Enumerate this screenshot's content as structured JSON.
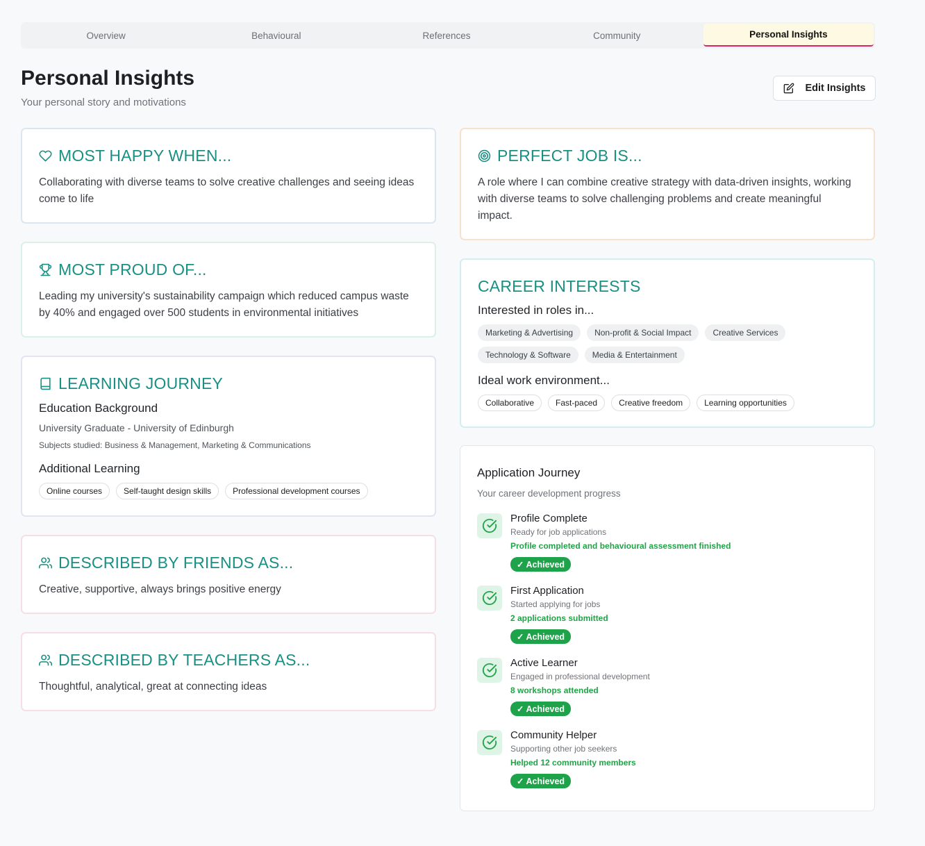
{
  "tabs": [
    "Overview",
    "Behavioural",
    "References",
    "Community",
    "Personal Insights"
  ],
  "header": {
    "title": "Personal Insights",
    "subtitle": "Your personal story and motivations",
    "edit_label": "Edit Insights"
  },
  "happy": {
    "title": "MOST HAPPY WHEN...",
    "body": "Collaborating with diverse teams to solve creative challenges and seeing ideas come to life"
  },
  "proud": {
    "title": "MOST PROUD OF...",
    "body": "Leading my university's sustainability campaign which reduced campus waste by 40% and engaged over 500 students in environmental initiatives"
  },
  "learning": {
    "title": "LEARNING JOURNEY",
    "edu_heading": "Education Background",
    "edu_line": "University Graduate - University of Edinburgh",
    "edu_subjects": "Subjects studied: Business & Management, Marketing & Communications",
    "additional_heading": "Additional Learning",
    "chips": [
      "Online courses",
      "Self-taught design skills",
      "Professional development courses"
    ]
  },
  "friends": {
    "title": "DESCRIBED BY FRIENDS AS...",
    "body": "Creative, supportive, always brings positive energy"
  },
  "teachers": {
    "title": "DESCRIBED BY TEACHERS AS...",
    "body": "Thoughtful, analytical, great at connecting ideas"
  },
  "perfect": {
    "title": "PERFECT JOB IS...",
    "body": "A role where I can combine creative strategy with data-driven insights, working with diverse teams to solve challenging problems and create meaningful impact."
  },
  "career": {
    "title": "CAREER INTERESTS",
    "roles_heading": "Interested in roles in...",
    "roles": [
      "Marketing & Advertising",
      "Non-profit & Social Impact",
      "Creative Services",
      "Technology & Software",
      "Media & Entertainment"
    ],
    "env_heading": "Ideal work environment...",
    "environments": [
      "Collaborative",
      "Fast-paced",
      "Creative freedom",
      "Learning opportunities"
    ]
  },
  "journey": {
    "title": "Application Journey",
    "subtitle": "Your career development progress",
    "milestones": [
      {
        "title": "Profile Complete",
        "desc": "Ready for job applications",
        "detail": "Profile completed and behavioural assessment finished",
        "badge": "✓ Achieved"
      },
      {
        "title": "First Application",
        "desc": "Started applying for jobs",
        "detail": "2 applications submitted",
        "badge": "✓ Achieved"
      },
      {
        "title": "Active Learner",
        "desc": "Engaged in professional development",
        "detail": "8 workshops attended",
        "badge": "✓ Achieved"
      },
      {
        "title": "Community Helper",
        "desc": "Supporting other job seekers",
        "detail": "Helped 12 community members",
        "badge": "✓ Achieved"
      }
    ]
  },
  "colors": {
    "accent_teal": "#1a8f84",
    "active_tab_underline": "#d6256f",
    "active_tab_bg": "#fdf9e3",
    "success_green": "#1ea34a"
  },
  "icons": {
    "happy": "heart-icon",
    "proud": "trophy-icon",
    "learning": "book-icon",
    "friends": "users-icon",
    "teachers": "users-icon",
    "perfect": "target-icon",
    "edit": "edit-icon",
    "milestone": "check-circle-icon"
  }
}
